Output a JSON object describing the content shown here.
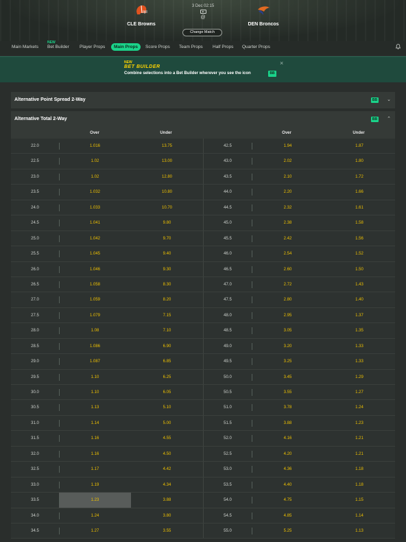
{
  "match": {
    "home_team": "CLE Browns",
    "away_team": "DEN Broncos",
    "date_time": "3 Dec 02:15",
    "at": "@",
    "change_match": "Change Match"
  },
  "tabs": [
    {
      "label": "Main Markets",
      "new": ""
    },
    {
      "label": "Bet Builder",
      "new": "NEW"
    },
    {
      "label": "Player Props",
      "new": ""
    },
    {
      "label": "Main Props",
      "new": "",
      "active": true
    },
    {
      "label": "Score Props",
      "new": ""
    },
    {
      "label": "Team Props",
      "new": ""
    },
    {
      "label": "Half Props",
      "new": ""
    },
    {
      "label": "Quarter Props",
      "new": ""
    }
  ],
  "banner": {
    "new": "NEW",
    "title": "BET BUILDER",
    "description": "Combine selections into a Bet Builder wherever you see the icon",
    "badge": "BB"
  },
  "sections": {
    "spread": {
      "label": "Alternative Point Spread 2-Way",
      "badge": "BB"
    },
    "total": {
      "label": "Alternative Total 2-Way",
      "badge": "BB"
    }
  },
  "table": {
    "headers": [
      "Over",
      "Under",
      "Over",
      "Under"
    ],
    "rows": [
      [
        "22.0",
        "1.016",
        "13.75",
        "42.5",
        "1.94",
        "1.87"
      ],
      [
        "22.5",
        "1.02",
        "13.00",
        "43.0",
        "2.02",
        "1.80"
      ],
      [
        "23.0",
        "1.02",
        "12.80",
        "43.5",
        "2.10",
        "1.72"
      ],
      [
        "23.5",
        "1.032",
        "10.80",
        "44.0",
        "2.20",
        "1.66"
      ],
      [
        "24.0",
        "1.033",
        "10.70",
        "44.5",
        "2.32",
        "1.61"
      ],
      [
        "24.5",
        "1.041",
        "9.80",
        "45.0",
        "2.38",
        "1.58"
      ],
      [
        "25.0",
        "1.042",
        "9.70",
        "45.5",
        "2.42",
        "1.56"
      ],
      [
        "25.5",
        "1.045",
        "9.40",
        "46.0",
        "2.54",
        "1.52"
      ],
      [
        "26.0",
        "1.046",
        "9.30",
        "46.5",
        "2.60",
        "1.50"
      ],
      [
        "26.5",
        "1.058",
        "8.30",
        "47.0",
        "2.72",
        "1.43"
      ],
      [
        "27.0",
        "1.059",
        "8.20",
        "47.5",
        "2.80",
        "1.40"
      ],
      [
        "27.5",
        "1.079",
        "7.15",
        "48.0",
        "2.95",
        "1.37"
      ],
      [
        "28.0",
        "1.08",
        "7.10",
        "48.5",
        "3.05",
        "1.35"
      ],
      [
        "28.5",
        "1.086",
        "6.90",
        "49.0",
        "3.20",
        "1.33"
      ],
      [
        "29.0",
        "1.087",
        "6.85",
        "49.5",
        "3.25",
        "1.33"
      ],
      [
        "29.5",
        "1.10",
        "6.25",
        "50.0",
        "3.45",
        "1.29"
      ],
      [
        "30.0",
        "1.10",
        "6.05",
        "50.5",
        "3.55",
        "1.27"
      ],
      [
        "30.5",
        "1.13",
        "5.10",
        "51.0",
        "3.78",
        "1.24"
      ],
      [
        "31.0",
        "1.14",
        "5.00",
        "51.5",
        "3.88",
        "1.23"
      ],
      [
        "31.5",
        "1.16",
        "4.55",
        "52.0",
        "4.16",
        "1.21"
      ],
      [
        "32.0",
        "1.16",
        "4.50",
        "52.5",
        "4.20",
        "1.21"
      ],
      [
        "32.5",
        "1.17",
        "4.42",
        "53.0",
        "4.36",
        "1.18"
      ],
      [
        "33.0",
        "1.19",
        "4.34",
        "53.5",
        "4.40",
        "1.18"
      ],
      [
        "33.5",
        "1.23",
        "3.88",
        "54.0",
        "4.75",
        "1.15"
      ],
      [
        "34.0",
        "1.24",
        "3.80",
        "54.5",
        "4.85",
        "1.14"
      ],
      [
        "34.5",
        "1.27",
        "3.55",
        "55.0",
        "5.25",
        "1.13"
      ]
    ],
    "selected_row": 23
  },
  "colors": {
    "accent": "#1ad38a",
    "odds": "#f0c200",
    "banner_bg": "#1f4a3d"
  }
}
